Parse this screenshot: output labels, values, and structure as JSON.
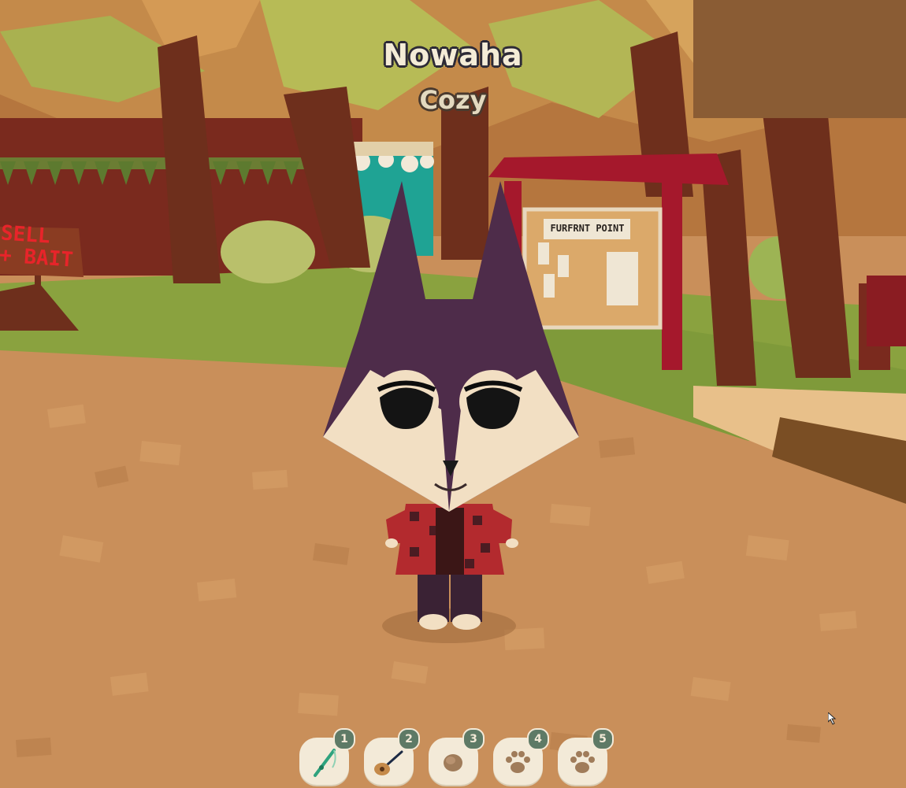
{
  "player": {
    "name": "Nowaha",
    "title": "Cozy"
  },
  "signs": {
    "sell_bait": "SELL\n+ BAIT",
    "notice_board": "FURFRNT POINT"
  },
  "hotbar": {
    "slots": [
      {
        "number": "1",
        "icon": "fishing-rod-icon"
      },
      {
        "number": "2",
        "icon": "ukulele-icon"
      },
      {
        "number": "3",
        "icon": "stone-icon"
      },
      {
        "number": "4",
        "icon": "paw-print-icon"
      },
      {
        "number": "5",
        "icon": "paw-print-icon"
      }
    ]
  },
  "colors": {
    "ground": "#c98f5a",
    "grass": "#7f9a3a",
    "tree_trunk": "#6e2f1c",
    "canopy": "#c48a4a",
    "fox_fur": "#4e2c4a",
    "shirt": "#b32a2e",
    "badge": "#5e7a66"
  }
}
